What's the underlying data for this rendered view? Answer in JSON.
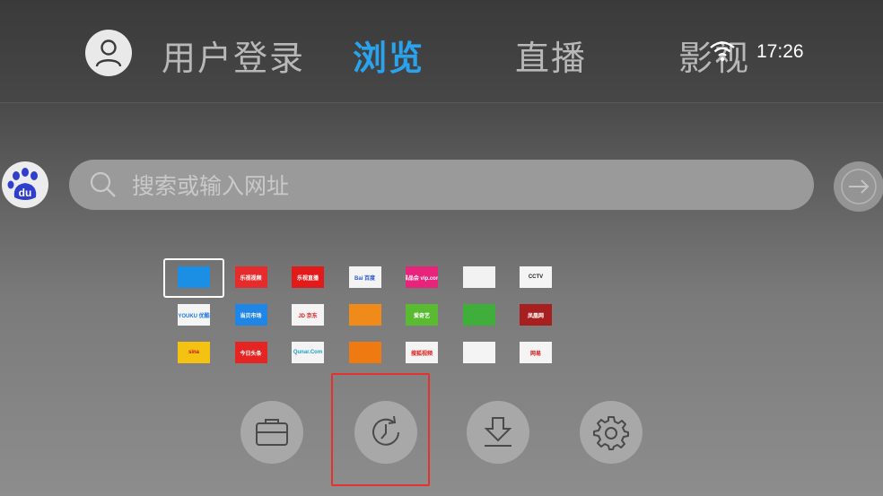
{
  "nav": {
    "tabs": [
      {
        "label": "用户登录",
        "active": false
      },
      {
        "label": "浏览",
        "active": true
      },
      {
        "label": "直播",
        "active": false
      },
      {
        "label": "影视",
        "active": false
      }
    ]
  },
  "status": {
    "time": "17:26",
    "wifi_icon": "wifi-icon"
  },
  "search": {
    "engine_label": "du",
    "placeholder": "搜索或输入网址"
  },
  "bookmarks": [
    {
      "name": "tv-guide",
      "label": "",
      "bg": "#1b8fe3",
      "fg": "#ffffff"
    },
    {
      "name": "le-video",
      "label": "乐视视频",
      "bg": "#e52b2b",
      "fg": "#ffffff"
    },
    {
      "name": "le-tv",
      "label": "乐视直播",
      "bg": "#e21a1a",
      "fg": "#ffffff"
    },
    {
      "name": "baidu",
      "label": "Bai 百度",
      "bg": "#f3f3f3",
      "fg": "#2a58d6"
    },
    {
      "name": "vip",
      "label": "唯品会 vip.com",
      "bg": "#e8237c",
      "fg": "#ffffff"
    },
    {
      "name": "tile-x",
      "label": "",
      "bg": "#f2f2f2",
      "fg": "#1e6fd6"
    },
    {
      "name": "cctv",
      "label": "CCTV",
      "bg": "#f4f4f4",
      "fg": "#222222"
    },
    {
      "name": "youku",
      "label": "YOUKU 优酷",
      "bg": "#f4f4f4",
      "fg": "#1e7ae0"
    },
    {
      "name": "dangbei",
      "label": "当贝市场",
      "bg": "#1f86e6",
      "fg": "#ffffff"
    },
    {
      "name": "jd",
      "label": "JD 京东",
      "bg": "#f4f4f4",
      "fg": "#e01f1f"
    },
    {
      "name": "letv-tile",
      "label": "",
      "bg": "#f08a18",
      "fg": "#ffffff"
    },
    {
      "name": "iqiyi",
      "label": "爱奇艺",
      "bg": "#5abb33",
      "fg": "#ffffff"
    },
    {
      "name": "green-tile",
      "label": "",
      "bg": "#3fae3a",
      "fg": "#ffffff"
    },
    {
      "name": "phoenix",
      "label": "凤凰网",
      "bg": "#a81f1f",
      "fg": "#ffffff"
    },
    {
      "name": "sina",
      "label": "sina",
      "bg": "#f5c211",
      "fg": "#c0161c"
    },
    {
      "name": "toutiao",
      "label": "今日头条",
      "bg": "#e52424",
      "fg": "#ffffff"
    },
    {
      "name": "qunar",
      "label": "Qunar.Com",
      "bg": "#f4f4f4",
      "fg": "#1aa0c6"
    },
    {
      "name": "search-tile",
      "label": "",
      "bg": "#f07a12",
      "fg": "#ffffff"
    },
    {
      "name": "sohu-video",
      "label": "搜狐视频",
      "bg": "#f4f4f4",
      "fg": "#e21e1e"
    },
    {
      "name": "tencent-video",
      "label": "",
      "bg": "#f4f4f4",
      "fg": "#1e8cde"
    },
    {
      "name": "netease",
      "label": "网易",
      "bg": "#f4f4f4",
      "fg": "#d31d1d"
    }
  ],
  "actions": [
    {
      "name": "files",
      "icon": "folder-icon"
    },
    {
      "name": "history",
      "icon": "history-icon"
    },
    {
      "name": "download",
      "icon": "download-icon"
    },
    {
      "name": "settings",
      "icon": "gear-icon"
    }
  ],
  "colors": {
    "accent": "#2aa3ee",
    "focus": "#e4332f"
  }
}
